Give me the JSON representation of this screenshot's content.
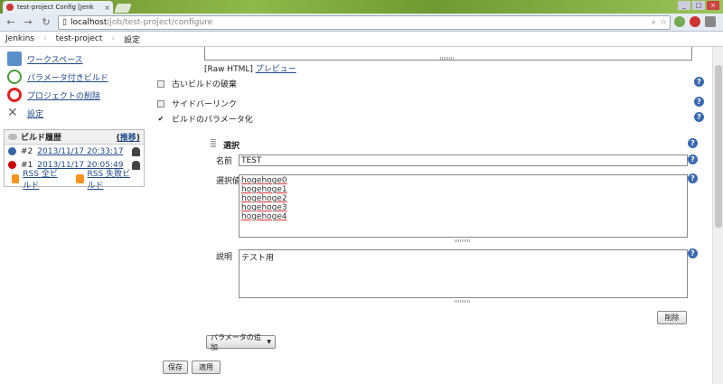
{
  "browser": {
    "tab_title": "test-project Config [Jenk",
    "tab_close": "×",
    "url_host": "localhost",
    "url_path": "/job/test-project/configure",
    "win_controls": [
      "_",
      "□",
      "×"
    ]
  },
  "breadcrumb": [
    "Jenkins",
    "test-project",
    "設定"
  ],
  "sidebar": {
    "items": [
      {
        "label": "ワークスペース",
        "icon": "folder-icon"
      },
      {
        "label": "パラメータ付きビルド",
        "icon": "clock-icon"
      },
      {
        "label": "プロジェクトの削除",
        "icon": "no-entry-icon"
      },
      {
        "label": "設定",
        "icon": "tools-icon"
      }
    ],
    "history": {
      "title": "ビルド履歴",
      "trend_open": "(",
      "trend": "推移",
      "trend_close": ")",
      "builds": [
        {
          "num": "#2",
          "date": "2013/11/17 20:33:17",
          "status_color": "#3465a4"
        },
        {
          "num": "#1",
          "date": "2013/11/17 20:05:49",
          "status_color": "#cc0000"
        }
      ],
      "rss_all": "RSS 全ビルド",
      "rss_failed": "RSS 失敗ビルド"
    }
  },
  "main": {
    "raw_html": "[Raw HTML]",
    "preview": "プレビュー",
    "options": [
      {
        "label": "古いビルドの破棄",
        "checked": false
      },
      {
        "label": "サイドバーリンク",
        "checked": false
      },
      {
        "label": "ビルドのパラメータ化",
        "checked": true
      }
    ],
    "check_mark": "✔",
    "param": {
      "type_label": "選択",
      "name_label": "名前",
      "name_value": "TEST",
      "choices_label": "選択値",
      "choices": [
        "hogehoge0",
        "hogehoge1",
        "hogehoge2",
        "hogehoge3",
        "hogehoge4"
      ],
      "desc_label": "説明",
      "desc_value": "テスト用",
      "delete_button": "削除"
    },
    "add_param_button": "パラメータの追加",
    "add_param_arrow": "▼",
    "save_button": "保存",
    "apply_button": "適用",
    "help_glyph": "?"
  }
}
